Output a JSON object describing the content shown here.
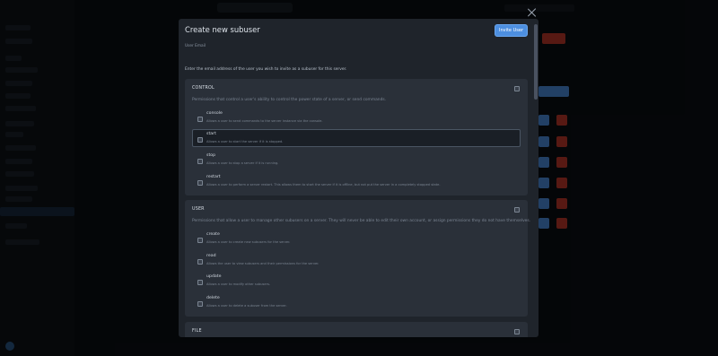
{
  "modal": {
    "title": "Create new subuser",
    "invite_button": "Invite User",
    "email_label": "User Email",
    "email_value": "",
    "help_text": "Enter the email address of the user you wish to invite as a subuser for this server."
  },
  "sections": [
    {
      "title": "CONTROL",
      "description": "Permissions that control a user's ability to control the power state of a server, or send commands.",
      "permissions": [
        {
          "name": "console",
          "description": "Allows a user to send commands to the server instance via the console."
        },
        {
          "name": "start",
          "description": "Allows a user to start the server if it is stopped."
        },
        {
          "name": "stop",
          "description": "Allows a user to stop a server if it is running."
        },
        {
          "name": "restart",
          "description": "Allows a user to perform a server restart. This allows them to start the server if it is offline, but not put the server in a completely stopped state."
        }
      ]
    },
    {
      "title": "USER",
      "description": "Permissions that allow a user to manage other subusers on a server. They will never be able to edit their own account, or assign permissions they do not have themselves.",
      "permissions": [
        {
          "name": "create",
          "description": "Allows a user to create new subusers for the server."
        },
        {
          "name": "read",
          "description": "Allows the user to view subusers and their permissions for the server."
        },
        {
          "name": "update",
          "description": "Allows a user to modify other subusers."
        },
        {
          "name": "delete",
          "description": "Allows a user to delete a subuser from the server."
        }
      ]
    },
    {
      "title": "FILE",
      "description": "",
      "permissions": []
    }
  ],
  "colors": {
    "accent": "#4d8fe0",
    "modal_bg": "#1f242b",
    "section_bg": "#2a3039",
    "danger": "#c0392b"
  },
  "icons": {
    "close": "close-icon",
    "checkbox": "checkbox-icon"
  }
}
